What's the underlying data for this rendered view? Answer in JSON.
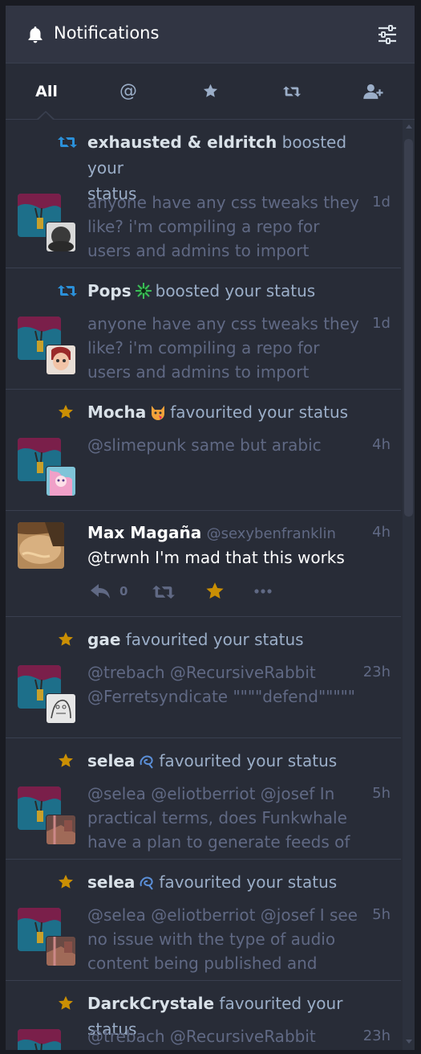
{
  "header": {
    "title": "Notifications",
    "icon": "bell-icon",
    "settings_icon": "sliders-icon"
  },
  "filters": [
    {
      "label": "All",
      "active": true
    },
    {
      "label": "@",
      "icon": "at-icon"
    },
    {
      "label": "",
      "icon": "star-icon"
    },
    {
      "label": "",
      "icon": "retweet-icon"
    },
    {
      "label": "",
      "icon": "user-plus-icon"
    }
  ],
  "items": [
    {
      "kind": "boost",
      "actor": "exhausted & eldritch",
      "action_line1": " boosted your",
      "action_line2": "status",
      "content": "anyone have any css tweaks they like? i'm compiling a repo for users and admins to import whichever",
      "time": "1d"
    },
    {
      "kind": "boost",
      "actor": "Pops",
      "action": "boosted your status",
      "content": "anyone have any css tweaks they like? i'm compiling a repo for users and admins to import whichever",
      "time": "1d"
    },
    {
      "kind": "favourite",
      "actor": "Mocha",
      "action": "favourited your status",
      "content": "@slimepunk same but arabic",
      "time": "4h"
    },
    {
      "kind": "mention",
      "display_name": "Max Magaña",
      "handle": "@sexybenfranklin",
      "content": "@trwnh I'm mad that this works",
      "time": "4h",
      "reply_count": "0"
    },
    {
      "kind": "favourite",
      "actor": "gae",
      "action": " favourited your status",
      "content": "@trebach @RecursiveRabbit @Ferretsyndicate \"\"\"\"defend\"\"\"\"\"",
      "time": "23h"
    },
    {
      "kind": "favourite",
      "actor": "selea",
      "action": "favourited your status",
      "content": "@selea @eliotberriot @josef In practical terms, does Funkwhale have a plan to generate feeds of",
      "time": "5h"
    },
    {
      "kind": "favourite",
      "actor": "selea",
      "action": "favourited your status",
      "content": "@selea @eliotberriot @josef I see no issue with the type of audio content being published and",
      "time": "5h"
    },
    {
      "kind": "favourite",
      "actor": "DarckCrystale",
      "action": " favourited your status",
      "content": "@trebach @RecursiveRabbit",
      "time": "23h"
    }
  ],
  "colors": {
    "boost": "#2b90d9",
    "favourite": "#ca8f04",
    "muted_text": "#606984",
    "secondary_text": "#9baec8"
  }
}
